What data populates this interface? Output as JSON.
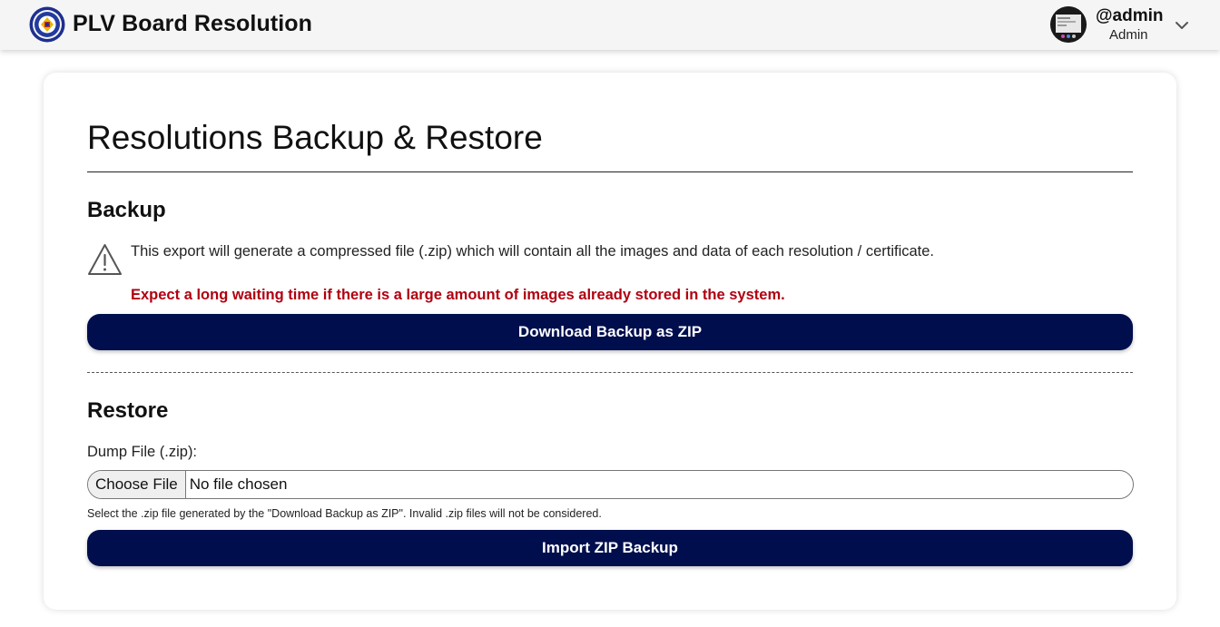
{
  "app": {
    "title": "PLV Board Resolution"
  },
  "user": {
    "name": "@admin",
    "role": "Admin"
  },
  "page": {
    "title": "Resolutions Backup & Restore"
  },
  "backup": {
    "heading": "Backup",
    "info": "This export will generate a compressed file (.zip) which will contain all the images and data of each resolution / certificate.",
    "warning": "Expect a long waiting time if there is a large amount of images already stored in the system.",
    "button_label": "Download Backup as ZIP"
  },
  "restore": {
    "heading": "Restore",
    "field_label": "Dump File (.zip):",
    "choose_label": "Choose File",
    "file_status": "No file chosen",
    "hint": "Select the .zip file generated by the \"Download Backup as ZIP\". Invalid .zip files will not be considered.",
    "button_label": "Import ZIP Backup"
  },
  "colors": {
    "primary_button": "#000e4d",
    "warning_text": "#b00010",
    "topbar_bg": "#f5f5f5"
  },
  "icons": {
    "logo": "plv-seal-logo",
    "warning": "warning-triangle-icon",
    "dropdown": "chevron-down-icon"
  }
}
